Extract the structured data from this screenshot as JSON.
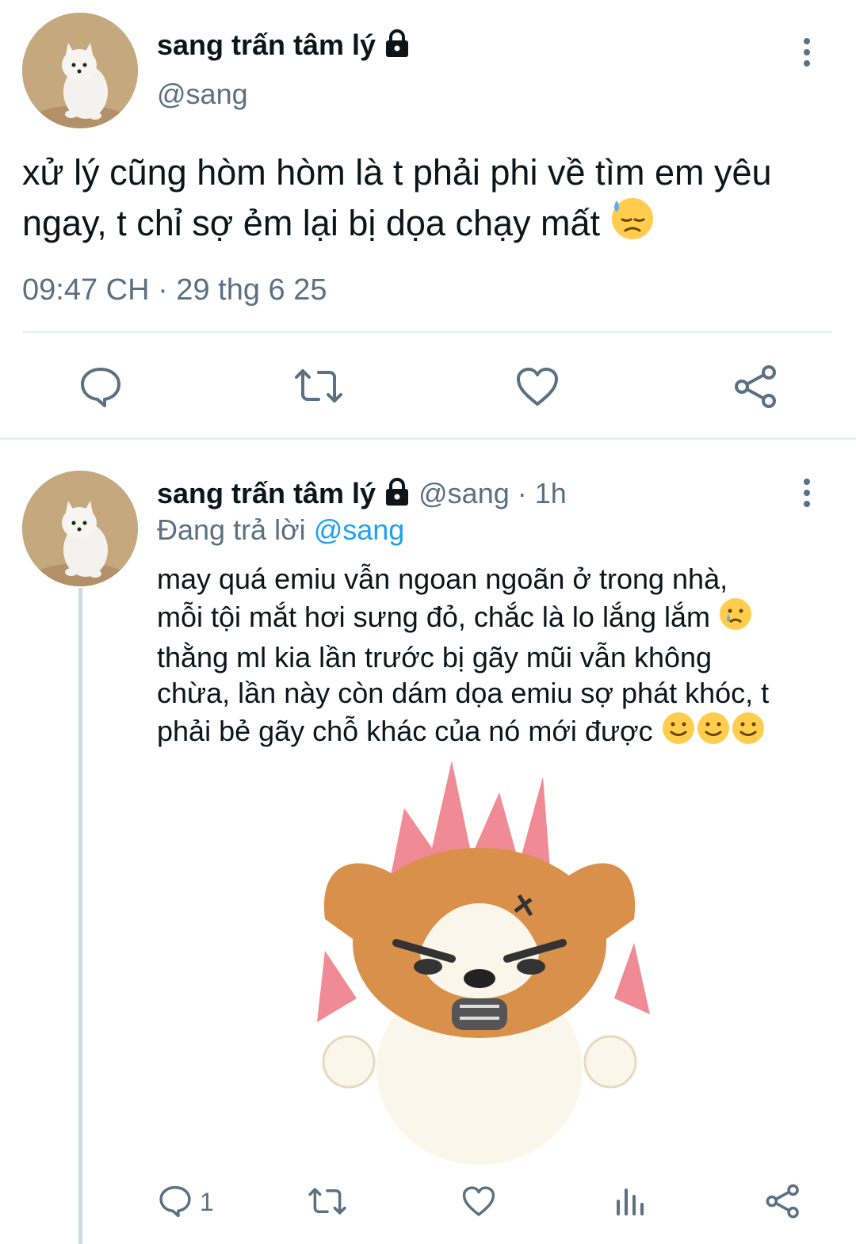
{
  "main_tweet": {
    "display_name": "sang trấn tâm lý",
    "handle": "@sang",
    "text": "xử lý cũng hòm hòm là t phải phi về tìm em yêu ngay, t chỉ sợ ẻm lại bị dọa chạy mất",
    "text_emoji": "downcast-face-with-sweat",
    "time": "09:47 CH · 29 thg 6 25",
    "actions": [
      "reply-icon",
      "retweet-icon",
      "like-icon",
      "share-icon"
    ]
  },
  "reply_tweet": {
    "display_name": "sang trấn tâm lý",
    "handle": "@sang",
    "separator": "·",
    "age": "1h",
    "replying_prefix": "Đang trả lời",
    "replying_to": "@sang",
    "line1": "may quá emiu vẫn ngoan ngoãn ở trong nhà,",
    "line2": "mỗi tội mắt hơi sưng đỏ, chắc là lo lắng lắm",
    "line3": "thằng ml kia lần trước bị gãy mũi vẫn không",
    "line4": "chừa, lần này còn dám dọa emiu sợ phát khóc, t",
    "line5": "phải bẻ gãy chỗ khác của nó mới được",
    "emojis": [
      "crying-face",
      "slightly-smiling-face",
      "slightly-smiling-face",
      "slightly-smiling-face"
    ],
    "media": "angry-corgi-sticker",
    "reply_count": "1",
    "actions": [
      "reply-icon",
      "retweet-icon",
      "like-icon",
      "analytics-icon",
      "share-icon"
    ]
  },
  "colors": {
    "text": "#0f1419",
    "muted": "#5b7083",
    "link": "#1da1f2",
    "divider": "#e6ecf0",
    "thread_line": "#cfd9de"
  }
}
